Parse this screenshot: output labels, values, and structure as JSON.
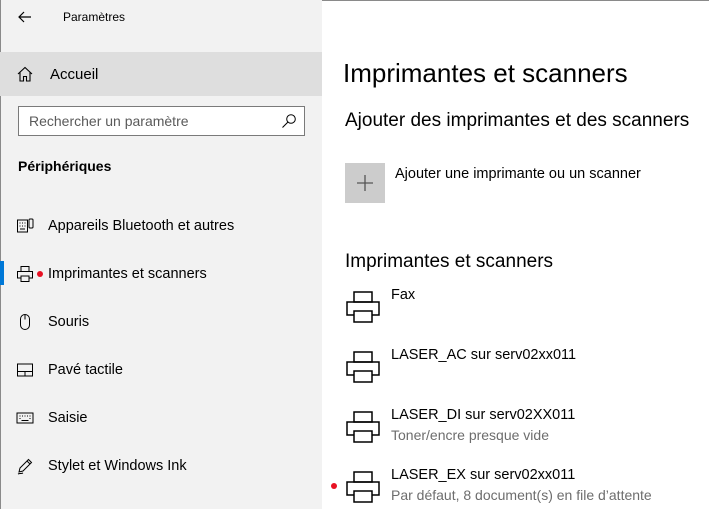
{
  "window": {
    "title": "Paramètres"
  },
  "sidebar": {
    "home_label": "Accueil",
    "search_placeholder": "Rechercher un paramètre",
    "section_label": "Périphériques",
    "items": [
      {
        "label": "Appareils Bluetooth et autres",
        "icon": "bluetooth-devices-icon"
      },
      {
        "label": "Imprimantes et scanners",
        "icon": "printer-icon",
        "active": true
      },
      {
        "label": "Souris",
        "icon": "mouse-icon"
      },
      {
        "label": "Pavé tactile",
        "icon": "touchpad-icon"
      },
      {
        "label": "Saisie",
        "icon": "keyboard-icon"
      },
      {
        "label": "Stylet et Windows Ink",
        "icon": "pen-icon"
      }
    ]
  },
  "main": {
    "page_title": "Imprimantes et scanners",
    "add_section_title": "Ajouter des imprimantes et des scanners",
    "add_button_label": "Ajouter une imprimante ou un scanner",
    "list_section_title": "Imprimantes et scanners",
    "printers": [
      {
        "name": "Fax",
        "status": ""
      },
      {
        "name": "LASER_AC sur serv02xx011",
        "status": ""
      },
      {
        "name": "LASER_DI sur serv02XX011",
        "status": "Toner/encre presque vide"
      },
      {
        "name": "LASER_EX sur serv02xx011",
        "status": "Par défaut, 8 document(s) en file d’attente"
      }
    ]
  },
  "colors": {
    "accent": "#0078d7",
    "marker": "#e81123",
    "sidebar_bg": "#f2f2f2",
    "selected_bg": "#dedede"
  }
}
